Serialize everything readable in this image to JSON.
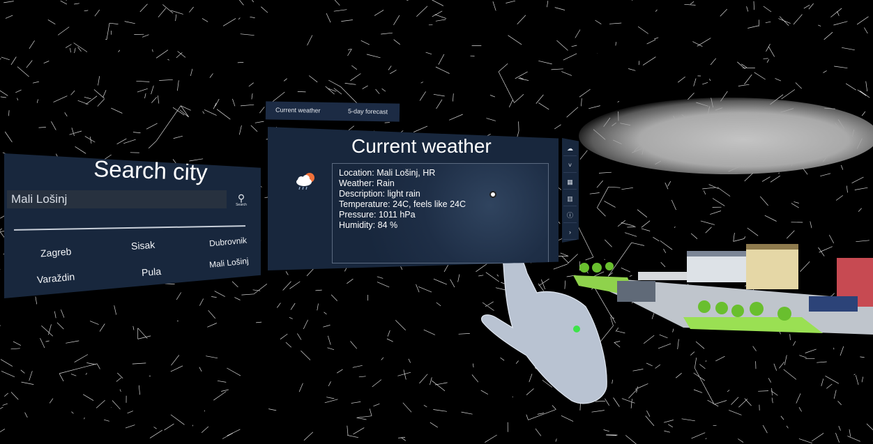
{
  "search_panel": {
    "title": "Search city",
    "input_value": "Mali Lošinj",
    "search_button_label": "Search",
    "cities": [
      "Zagreb",
      "Sisak",
      "Dubrovnik",
      "Varaždin",
      "Pula",
      "Mali Lošinj"
    ]
  },
  "tabs": [
    "Current weather",
    "5-day forecast"
  ],
  "weather_panel": {
    "title": "Current weather",
    "weather_icon": "cloud-rain-sun-icon",
    "lines": [
      "Location: Mali Lošinj, HR",
      "Weather: Rain",
      "Description: light rain",
      "Temperature: 24C, feels like 24C",
      "Pressure: 1011 hPa",
      "Humidity: 84 %"
    ]
  },
  "side_toolbar": {
    "icons": [
      "cloud-icon",
      "chevron-icon",
      "map-icon",
      "city-icon",
      "info-icon",
      "next-arrow-icon"
    ]
  },
  "colors": {
    "panel_bg": "#18273d",
    "text": "#ffffff",
    "mesh": "#ffffff",
    "background": "#000000",
    "hand": "#b9c3d2",
    "pointer_dot": "#3ee34a"
  }
}
